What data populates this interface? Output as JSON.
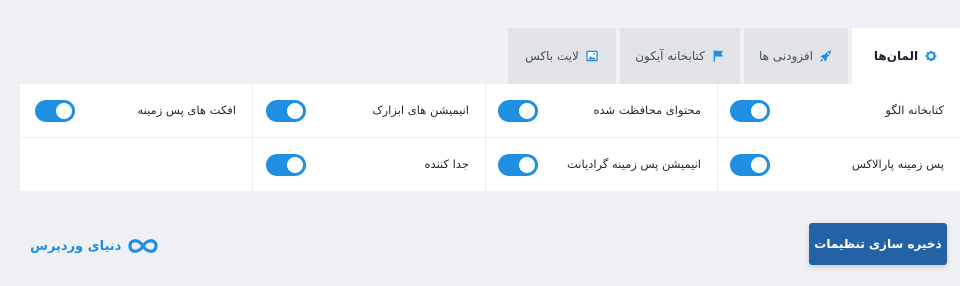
{
  "tabs": [
    {
      "id": "elements",
      "label": "المان‌ها",
      "icon": "gear-icon"
    },
    {
      "id": "extensions",
      "label": "افزودنی ها",
      "icon": "rocket-icon"
    },
    {
      "id": "icon_library",
      "label": "کتابخانه آیکون",
      "icon": "flag-icon"
    },
    {
      "id": "lightbox",
      "label": "لایت باکس",
      "icon": "image-icon"
    }
  ],
  "active_tab": "افزودنی ها",
  "settings": [
    {
      "label": "کتابخانه الگو",
      "enabled": true
    },
    {
      "label": "محتوای محافظت شده",
      "enabled": true
    },
    {
      "label": "انیمیشن های ابزارک",
      "enabled": true
    },
    {
      "label": "افکت های پس زمینه",
      "enabled": true
    },
    {
      "label": "پس زمینه پارالاکس",
      "enabled": true
    },
    {
      "label": "انیمیشن پس زمینه گرادیانت",
      "enabled": true
    },
    {
      "label": "جدا کننده",
      "enabled": true
    }
  ],
  "save_button": "ذخیره سازی تنظیمات",
  "brand": {
    "name": "دنیای وردپرس",
    "logo": "infinity-logo-icon"
  },
  "colors": {
    "accent": "#1e8fe1",
    "button": "#2462a6",
    "background": "#eff0f4"
  }
}
